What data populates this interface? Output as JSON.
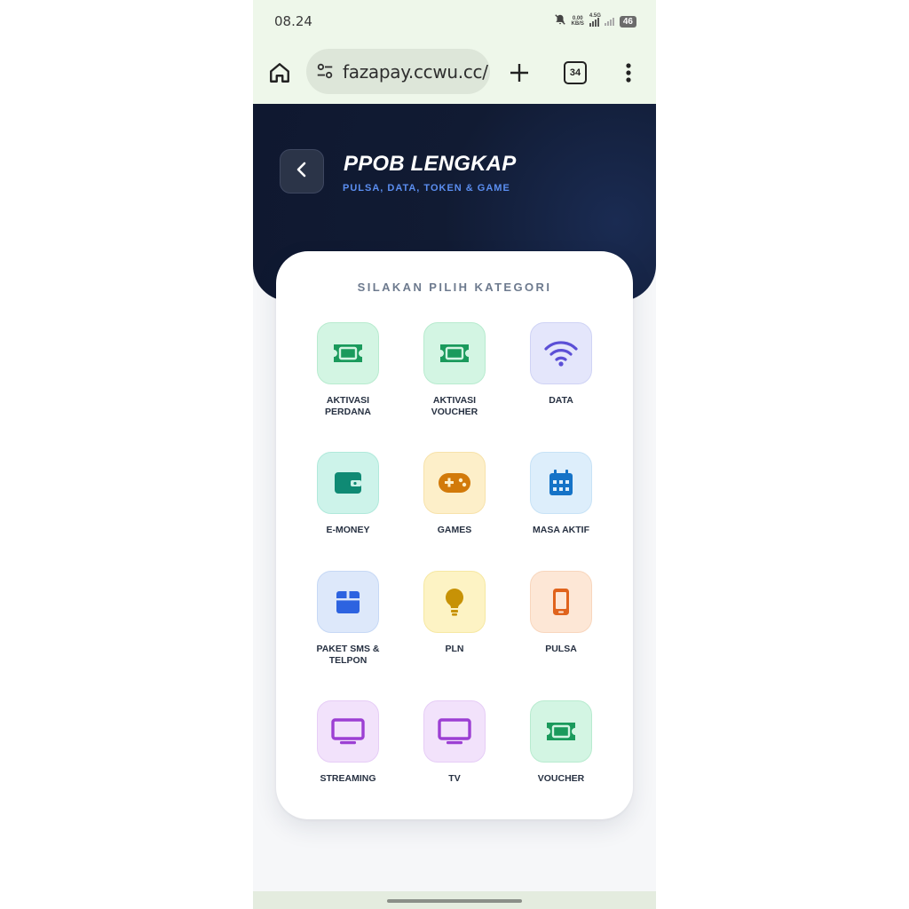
{
  "status_bar": {
    "time": "08.24",
    "net_speed_value": "0.00",
    "net_speed_unit": "KB/S",
    "network": "4.5G",
    "battery": "46"
  },
  "browser": {
    "url": "fazapay.ccwu.cc/",
    "tab_count": "34"
  },
  "header": {
    "title": "PPOB LENGKAP",
    "subtitle": "PULSA, DATA, TOKEN & GAME"
  },
  "card": {
    "title": "SILAKAN PILIH KATEGORI"
  },
  "categories": [
    {
      "label": "AKTIVASI\nPERDANA",
      "icon": "ticket-icon",
      "bg": "#d3f5e3",
      "border": "#b8ebcf",
      "color": "#1a9a5c"
    },
    {
      "label": "AKTIVASI\nVOUCHER",
      "icon": "ticket-icon",
      "bg": "#d3f5e3",
      "border": "#b8ebcf",
      "color": "#1a9a5c"
    },
    {
      "label": "DATA",
      "icon": "wifi-icon",
      "bg": "#e4e6fb",
      "border": "#cfd3f5",
      "color": "#5b4fd6"
    },
    {
      "label": "E-MONEY",
      "icon": "wallet-icon",
      "bg": "#cdf3ea",
      "border": "#b0e9db",
      "color": "#0f8a74"
    },
    {
      "label": "GAMES",
      "icon": "gamepad-icon",
      "bg": "#fdefc9",
      "border": "#f7e2ab",
      "color": "#d27a0a"
    },
    {
      "label": "MASA AKTIF",
      "icon": "calendar-icon",
      "bg": "#ddeefb",
      "border": "#c7e2f6",
      "color": "#1573c7"
    },
    {
      "label": "PAKET SMS &\nTELPON",
      "icon": "box-icon",
      "bg": "#dde8fa",
      "border": "#c6d8f5",
      "color": "#2d63e0"
    },
    {
      "label": "PLN",
      "icon": "lightbulb-icon",
      "bg": "#fdf3c4",
      "border": "#f6e8a3",
      "color": "#c79206"
    },
    {
      "label": "PULSA",
      "icon": "phone-icon",
      "bg": "#fde7d6",
      "border": "#f8d6bd",
      "color": "#e0631c"
    },
    {
      "label": "STREAMING",
      "icon": "monitor-icon",
      "bg": "#f2e2fb",
      "border": "#e6cdf6",
      "color": "#9c3fd3"
    },
    {
      "label": "TV",
      "icon": "monitor-icon",
      "bg": "#f2e2fb",
      "border": "#e6cdf6",
      "color": "#9c3fd3"
    },
    {
      "label": "VOUCHER",
      "icon": "ticket-icon",
      "bg": "#d3f5e3",
      "border": "#b8ebcf",
      "color": "#1a9a5c"
    }
  ]
}
